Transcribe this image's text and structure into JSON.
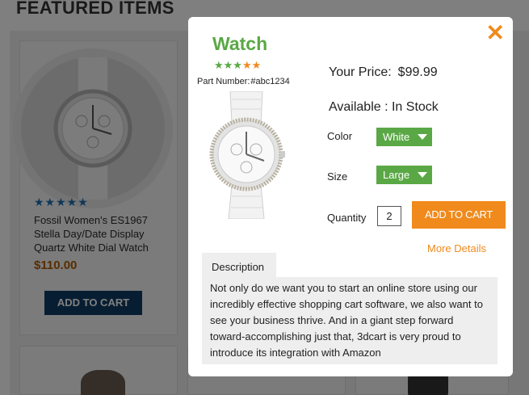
{
  "background": {
    "section_title": "FEATURED ITEMS",
    "card": {
      "stars": "★★★★★",
      "name": "Fossil Women's ES1967 Stella Day/Date Display Quartz White Dial Watch",
      "price": "$110.00",
      "button_label": "ADD TO CART"
    }
  },
  "modal": {
    "close_glyph": "✕",
    "product_name": "Watch",
    "stars": {
      "green": "★★★",
      "orange": "★★"
    },
    "rating": 5,
    "part_number_label": "Part Number:",
    "part_number": "#abc1234",
    "price_label": "Your Price:",
    "price_value": "$99.99",
    "availability": "Available : In Stock",
    "color_label": "Color",
    "color_value": "White",
    "size_label": "Size",
    "size_value": "Large",
    "quantity_label": "Quantity",
    "quantity_value": "2",
    "add_to_cart_label": "ADD TO CART",
    "more_details_label": "More Details",
    "description_tab": "Description",
    "description_text": "Not only do we want you to start an online store using our incredibly effective shopping cart software, we also want to see your business thrive. And in a giant step forward toward-accomplishing just that, 3dcart is very proud to introduce its integration with Amazon"
  },
  "colors": {
    "accent_green": "#5aa845",
    "accent_orange": "#f08a1c",
    "bg_button_navy": "#0f3d64"
  }
}
